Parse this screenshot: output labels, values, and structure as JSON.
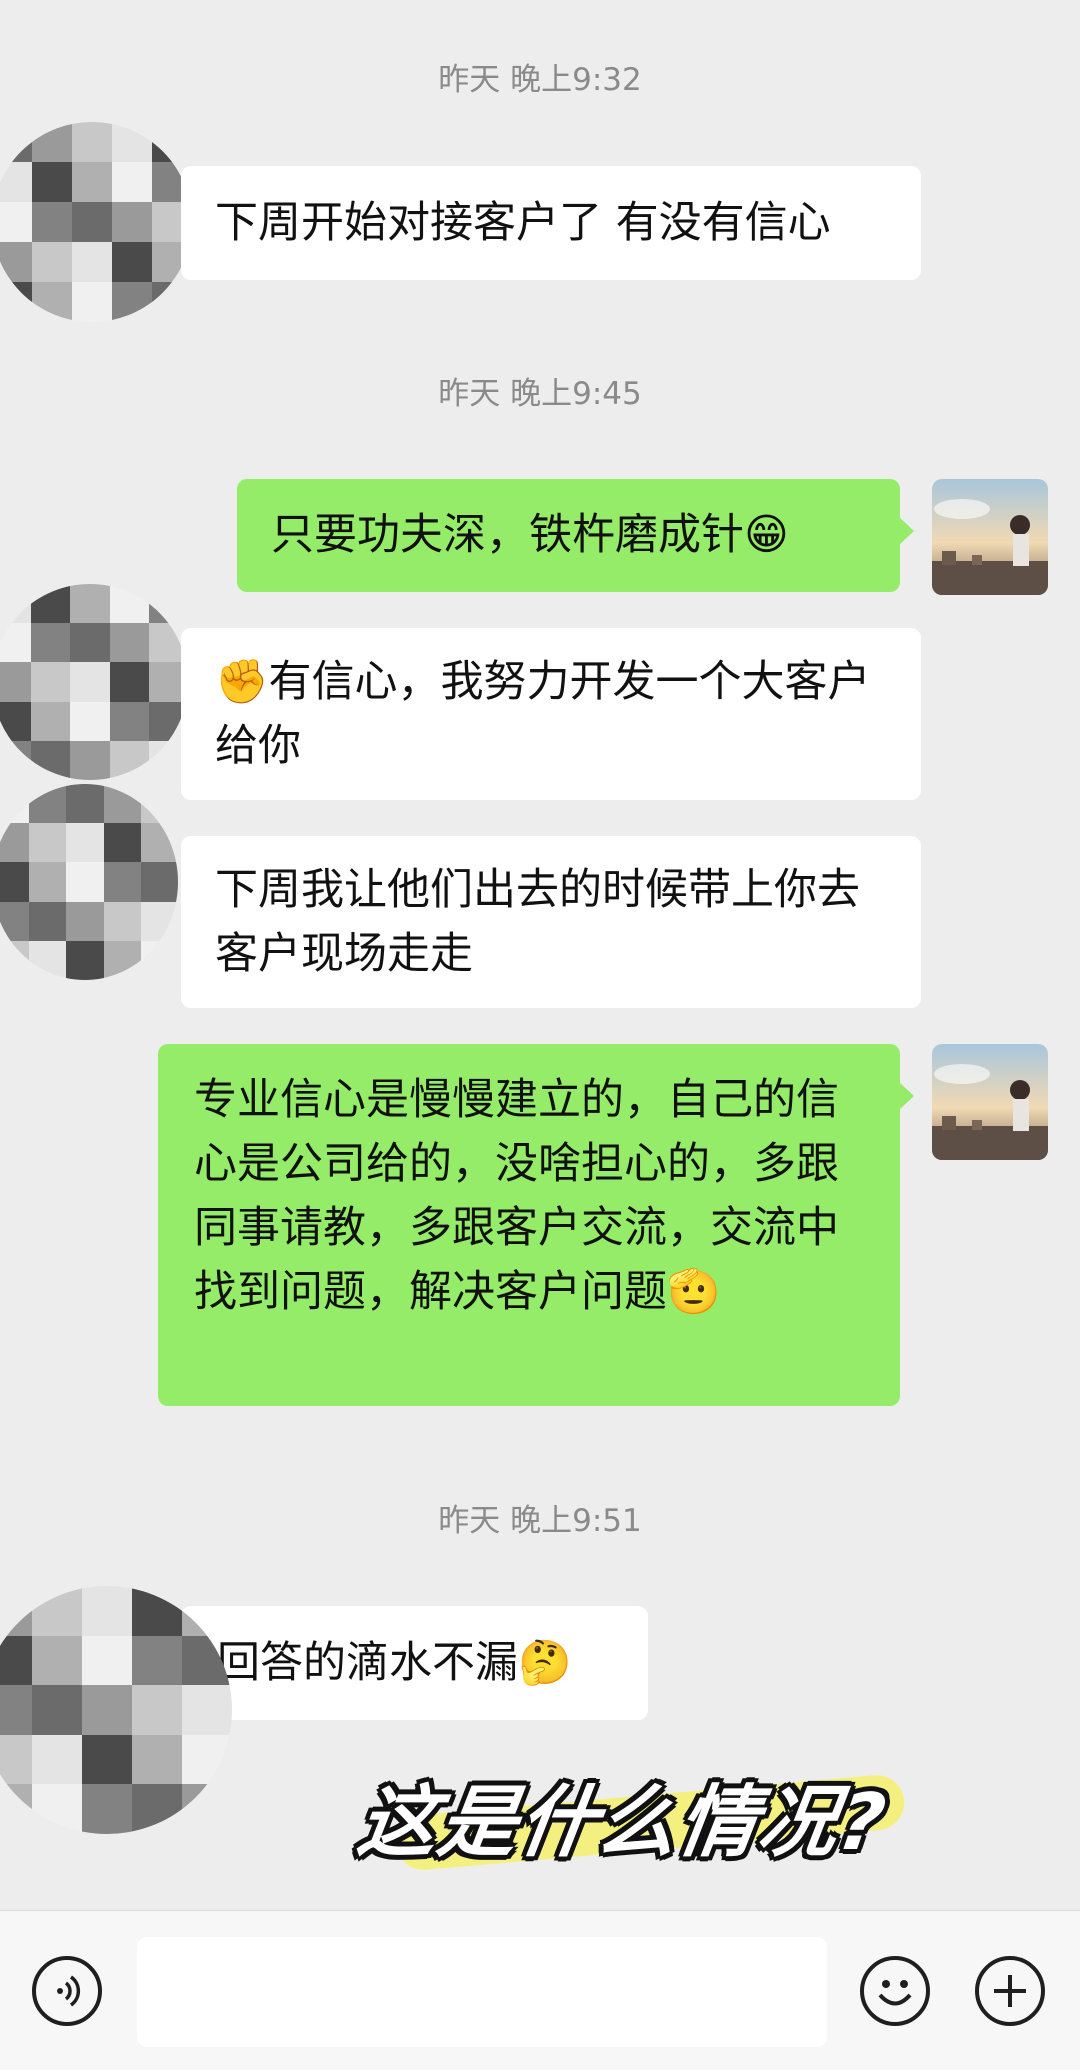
{
  "timestamps": [
    "昨天 晚上9:32",
    "昨天 晚上9:45",
    "昨天 晚上9:51"
  ],
  "messages": [
    {
      "side": "left",
      "text": "下周开始对接客户了 有没有信心"
    },
    {
      "side": "right",
      "text": "只要功夫深，铁杵磨成针😁"
    },
    {
      "side": "left",
      "text": "✊有信心，我努力开发一个大客户给你"
    },
    {
      "side": "left",
      "text": "下周我让他们出去的时候带上你去客户现场走走"
    },
    {
      "side": "right",
      "text": "专业信心是慢慢建立的，自己的信心是公司给的，没啥担心的，多跟同事请教，多跟客户交流，交流中找到问题，解决客户问题🫡"
    },
    {
      "side": "left",
      "text": "回答的滴水不漏🤔"
    }
  ],
  "overlay_caption": "这是什么情况?",
  "input_bar": {
    "voice_icon": "voice-icon",
    "emoji_icon": "emoji-icon",
    "plus_icon": "plus-icon",
    "input_value": ""
  },
  "colors": {
    "background": "#ededed",
    "bubble_incoming": "#ffffff",
    "bubble_outgoing": "#95ec69",
    "timestamp": "#8a8a8a"
  }
}
